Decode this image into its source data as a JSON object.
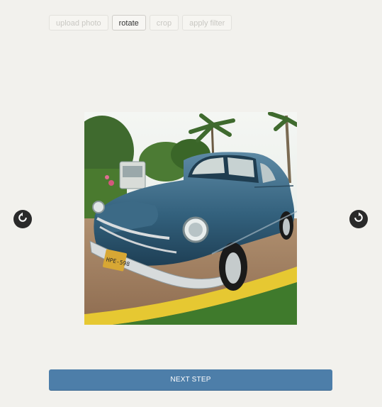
{
  "toolbar": {
    "tabs": [
      {
        "label": "upload photo",
        "active": false
      },
      {
        "label": "rotate",
        "active": true
      },
      {
        "label": "crop",
        "active": false
      },
      {
        "label": "apply filter",
        "active": false
      }
    ]
  },
  "editor": {
    "rotate_left_icon": "rotate-left-icon",
    "rotate_right_icon": "rotate-right-icon"
  },
  "actions": {
    "next_label": "NEXT STEP"
  },
  "colors": {
    "background": "#f2f1ed",
    "primary_button": "#4d7ea9",
    "rotate_button": "#2a2a2a"
  }
}
